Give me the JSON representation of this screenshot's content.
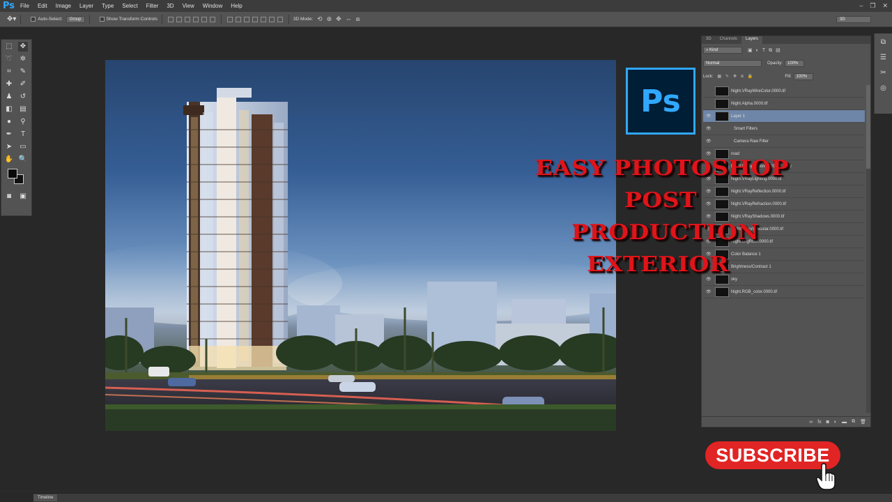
{
  "app": {
    "logo": "Ps",
    "menu": [
      "File",
      "Edit",
      "Image",
      "Layer",
      "Type",
      "Select",
      "Filter",
      "3D",
      "View",
      "Window",
      "Help"
    ],
    "window_controls": [
      "–",
      "❐",
      "✕"
    ]
  },
  "options": {
    "auto_select_label": "Auto-Select:",
    "group_value": "Group",
    "show_transform": "Show Transform Controls",
    "mode_3d": "3D Mode:",
    "workspace": "3D"
  },
  "panel": {
    "tabs": [
      "3D",
      "Channels",
      "Layers"
    ],
    "kind": "Kind",
    "blend_mode": "Normal",
    "opacity_label": "Opacity:",
    "opacity": "100%",
    "lock_label": "Lock:",
    "fill_label": "Fill:",
    "fill": "100%",
    "layers": [
      {
        "name": "Night.VRayWireColor.0000.tif",
        "visible": false
      },
      {
        "name": "Night.Alpha.0000.tif",
        "visible": false
      },
      {
        "name": "Layer 1",
        "visible": true,
        "selected": true
      },
      {
        "name": "Smart Filters",
        "visible": true,
        "sub": true
      },
      {
        "name": "Camera Raw Filter",
        "visible": true,
        "sub": true
      },
      {
        "name": "road",
        "visible": true
      },
      {
        "name": "Night.VRayLighting.0000.tif copy",
        "visible": true
      },
      {
        "name": "Night.VRayLighting.0000.tif",
        "visible": true
      },
      {
        "name": "Night.VRayReflection.0000.tif",
        "visible": true
      },
      {
        "name": "Night.VRayRefraction.0000.tif",
        "visible": true
      },
      {
        "name": "Night.VRayShadows.0000.tif",
        "visible": true
      },
      {
        "name": "Night.VRaySpecular.0000.tif",
        "visible": true
      },
      {
        "name": "Night.origRGB.0000.tif",
        "visible": true
      },
      {
        "name": "Color Balance 1",
        "visible": true
      },
      {
        "name": "Brightness/Contrast 1",
        "visible": true
      },
      {
        "name": "sky",
        "visible": true
      },
      {
        "name": "Night.RGB_color.0000.tif",
        "visible": true
      }
    ]
  },
  "overlay": {
    "ps_logo": "Ps",
    "headline": [
      "EASY PHOTOSHOP",
      "POST",
      "PRODUCTION",
      "EXTERIOR"
    ],
    "subscribe": "SUBSCRIBE"
  },
  "timeline": {
    "label": "Timeline"
  },
  "colors": {
    "accent": "#31a8ff",
    "headline": "#e0141a",
    "subscribe": "#e12424"
  }
}
